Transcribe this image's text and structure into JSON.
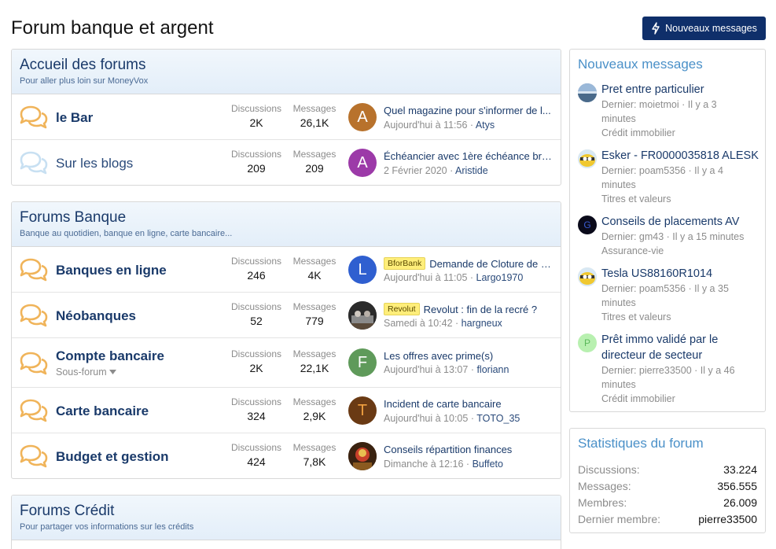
{
  "page": {
    "title": "Forum banque et argent",
    "new_posts_button": "Nouveaux messages"
  },
  "labels": {
    "discussions": "Discussions",
    "messages": "Messages",
    "subforum": "Sous-forum"
  },
  "categories": [
    {
      "title": "Accueil des forums",
      "description": "Pour aller plus loin sur MoneyVox",
      "nodes": [
        {
          "title": "le Bar",
          "discussions": "2K",
          "messages": "26,1K",
          "last_title": "Quel magazine pour s'informer de l...",
          "last_date": "Aujourd'hui à 11:56",
          "last_user": "Atys",
          "avatar_letter": "A"
        },
        {
          "title": "Sur les blogs",
          "discussions": "209",
          "messages": "209",
          "last_title": "Échéancier avec 1ère échéance bris...",
          "last_date": "2 Février 2020",
          "last_user": "Aristide",
          "avatar_letter": "A"
        }
      ]
    },
    {
      "title": "Forums Banque",
      "description": "Banque au quotidien, banque en ligne, carte bancaire...",
      "nodes": [
        {
          "title": "Banques en ligne",
          "discussions": "246",
          "messages": "4K",
          "prefix": "BforBank",
          "last_title": "Demande de Cloture de c...",
          "last_date": "Aujourd'hui à 11:05",
          "last_user": "Largo1970",
          "avatar_letter": "L"
        },
        {
          "title": "Néobanques",
          "discussions": "52",
          "messages": "779",
          "prefix": "Revolut",
          "last_title": "Revolut : fin de la recré ?",
          "last_date": "Samedi à 10:42",
          "last_user": "hargneux",
          "avatar_letter": ""
        },
        {
          "title": "Compte bancaire",
          "discussions": "2K",
          "messages": "22,1K",
          "last_title": "Les offres avec prime(s)",
          "last_date": "Aujourd'hui à 13:07",
          "last_user": "floriann",
          "avatar_letter": "F"
        },
        {
          "title": "Carte bancaire",
          "discussions": "324",
          "messages": "2,9K",
          "last_title": "Incident de carte bancaire",
          "last_date": "Aujourd'hui à 10:05",
          "last_user": "TOTO_35",
          "avatar_letter": "T"
        },
        {
          "title": "Budget et gestion",
          "discussions": "424",
          "messages": "7,8K",
          "last_title": "Conseils répartition finances",
          "last_date": "Dimanche à 12:16",
          "last_user": "Buffeto",
          "avatar_letter": ""
        }
      ]
    },
    {
      "title": "Forums Crédit",
      "description": "Pour partager vos informations sur les crédits",
      "nodes": []
    }
  ],
  "sidebar_new_posts": {
    "title": "Nouveaux messages",
    "items": [
      {
        "title": "Pret entre particulier",
        "meta_line1": "Dernier: moietmoi · Il y a 3",
        "meta_line2": "minutes",
        "forum": "Crédit immobilier",
        "avatar_letter": ""
      },
      {
        "title": "Esker - FR0000035818 ALESK",
        "meta_line1": "Dernier: poam5356 · Il y a 4",
        "meta_line2": "minutes",
        "forum": "Titres et valeurs",
        "avatar_letter": ""
      },
      {
        "title": "Conseils de placements AV",
        "meta_line1": "Dernier: gm43 · Il y a 15 minutes",
        "meta_line2": "",
        "forum": "Assurance-vie",
        "avatar_letter": "G"
      },
      {
        "title": "Tesla US88160R1014",
        "meta_line1": "Dernier: poam5356 · Il y a 35",
        "meta_line2": "minutes",
        "forum": "Titres et valeurs",
        "avatar_letter": ""
      },
      {
        "title_line1": "Prêt immo validé par le",
        "title_line2": "directeur de secteur",
        "meta_line1": "Dernier: pierre33500 · Il y a 46",
        "meta_line2": "minutes",
        "forum": "Crédit immobilier",
        "avatar_letter": "P"
      }
    ]
  },
  "forum_stats": {
    "title": "Statistiques du forum",
    "rows": [
      {
        "label": "Discussions:",
        "value": "33.224"
      },
      {
        "label": "Messages:",
        "value": "356.555"
      },
      {
        "label": "Membres:",
        "value": "26.009"
      },
      {
        "label": "Dernier membre:",
        "value": "pierre33500"
      }
    ]
  },
  "colors": {
    "accent": "#0f2f6a",
    "link": "#1a3a6a",
    "side_title": "#4a90c8",
    "unread_icon": "#f0b45a",
    "read_icon": "#c8e0f2"
  }
}
